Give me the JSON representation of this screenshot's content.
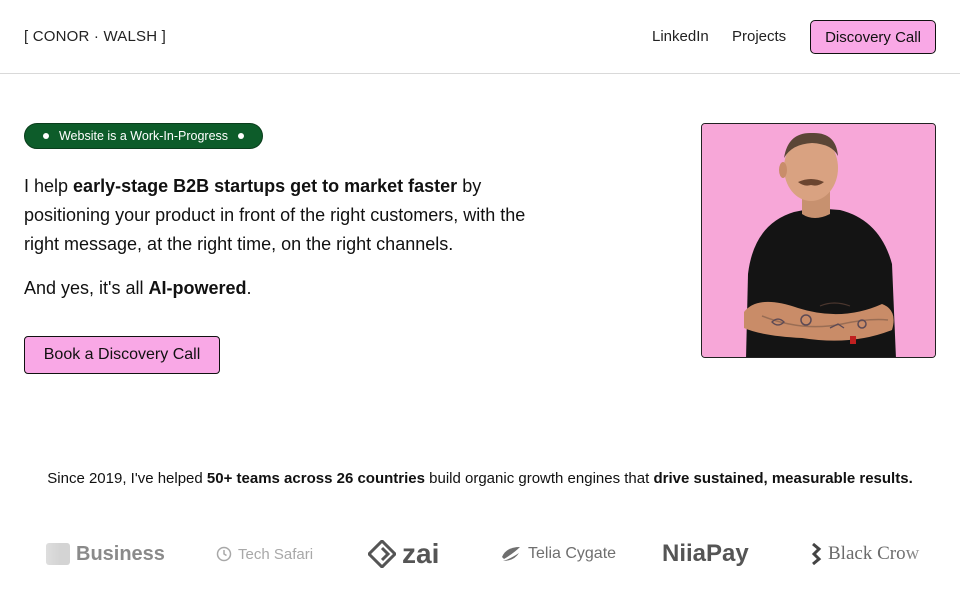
{
  "header": {
    "brand": "[ CONOR · WALSH ]",
    "nav": {
      "linkedin": "LinkedIn",
      "projects": "Projects",
      "cta": "Discovery Call"
    }
  },
  "hero": {
    "badge": "Website is a Work-In-Progress",
    "intro": {
      "p1": "I help ",
      "bold1": "early-stage B2B startups get to market faster",
      "p2": " by positioning your product in front of the right customers, with the right message, at the right time, on the right channels."
    },
    "tagline": {
      "p1": "And yes, it's all ",
      "bold": "AI-powered",
      "p2": "."
    },
    "cta": "Book a Discovery Call",
    "photo_bg": "#f7a7d8"
  },
  "stats": {
    "p1": "Since 2019, I've helped ",
    "bold1": "50+ teams across 26 countries",
    "p2": " build organic growth engines that ",
    "bold2": "drive sustained, measurable results."
  },
  "logos": [
    {
      "name": "Business",
      "icon": "square-icon"
    },
    {
      "name": "Tech Safari",
      "icon": "clock-icon"
    },
    {
      "name": "zai",
      "icon": "diamond-icon"
    },
    {
      "name": "Telia Cygate",
      "icon": "telia-icon"
    },
    {
      "name": "NiiaPay",
      "icon": ""
    },
    {
      "name": "Black Crow",
      "icon": "crow-icon"
    }
  ],
  "colors": {
    "accent_pink": "#f9a8e6",
    "badge_green": "#0d5c2a"
  }
}
